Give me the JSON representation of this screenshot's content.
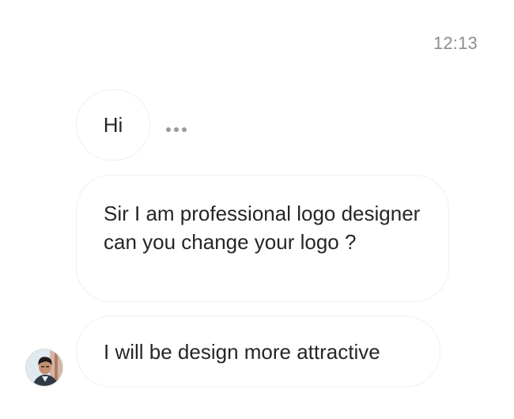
{
  "conversation": {
    "timestamp": "12:13",
    "messages": [
      {
        "text": "Hi"
      },
      {
        "text": "Sir I am professional logo designer can you change your logo ?"
      },
      {
        "text": "I will be design more attractive"
      }
    ]
  },
  "icons": {
    "more_options": "more-horizontal-icon",
    "avatar": "user-avatar"
  },
  "colors": {
    "bubble_border": "#efefef",
    "text": "#262626",
    "timestamp": "#8e8e8e"
  }
}
